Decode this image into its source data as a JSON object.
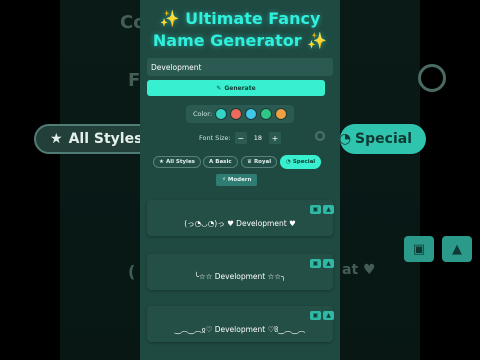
{
  "background": {
    "title_fragment": "Co",
    "input_fragment": "F",
    "pill_all": "All Styles",
    "pill_special": "Special",
    "star_icon": "★",
    "special_icon": "◔",
    "ghost_result_left": "(",
    "ghost_result_right": "at ♥"
  },
  "app": {
    "title_line1": "Ultimate Fancy",
    "title_line2": "Name Generator",
    "sparkle": "✨"
  },
  "input": {
    "value": "Development",
    "placeholder": ""
  },
  "generate_label": "Generate",
  "pencil_icon": "✎",
  "color": {
    "label": "Color:",
    "swatches": [
      "#33d6c6",
      "#ee6b5b",
      "#3fc8e8",
      "#2ec786",
      "#f0a040"
    ]
  },
  "font_size": {
    "label": "Font Size:",
    "minus": "−",
    "value": "18",
    "plus": "+"
  },
  "filters": [
    {
      "icon": "★",
      "label": "All Styles"
    },
    {
      "icon": "A",
      "label": "Basic"
    },
    {
      "icon": "♛",
      "label": "Royal"
    },
    {
      "icon": "◔",
      "label": "Special"
    },
    {
      "icon": "⚡",
      "label": "Modern"
    }
  ],
  "results": [
    "(っ◔◡◔)っ ♥ Development ♥",
    "╰☆☆ Development ☆☆╮",
    "‿︵‿︵ჲ♡ Development ♡ჱ‿︵‿︵"
  ],
  "colors": {
    "accent": "#38f0cf",
    "panel": "#1f4a42",
    "title": "#2ff0dc"
  }
}
